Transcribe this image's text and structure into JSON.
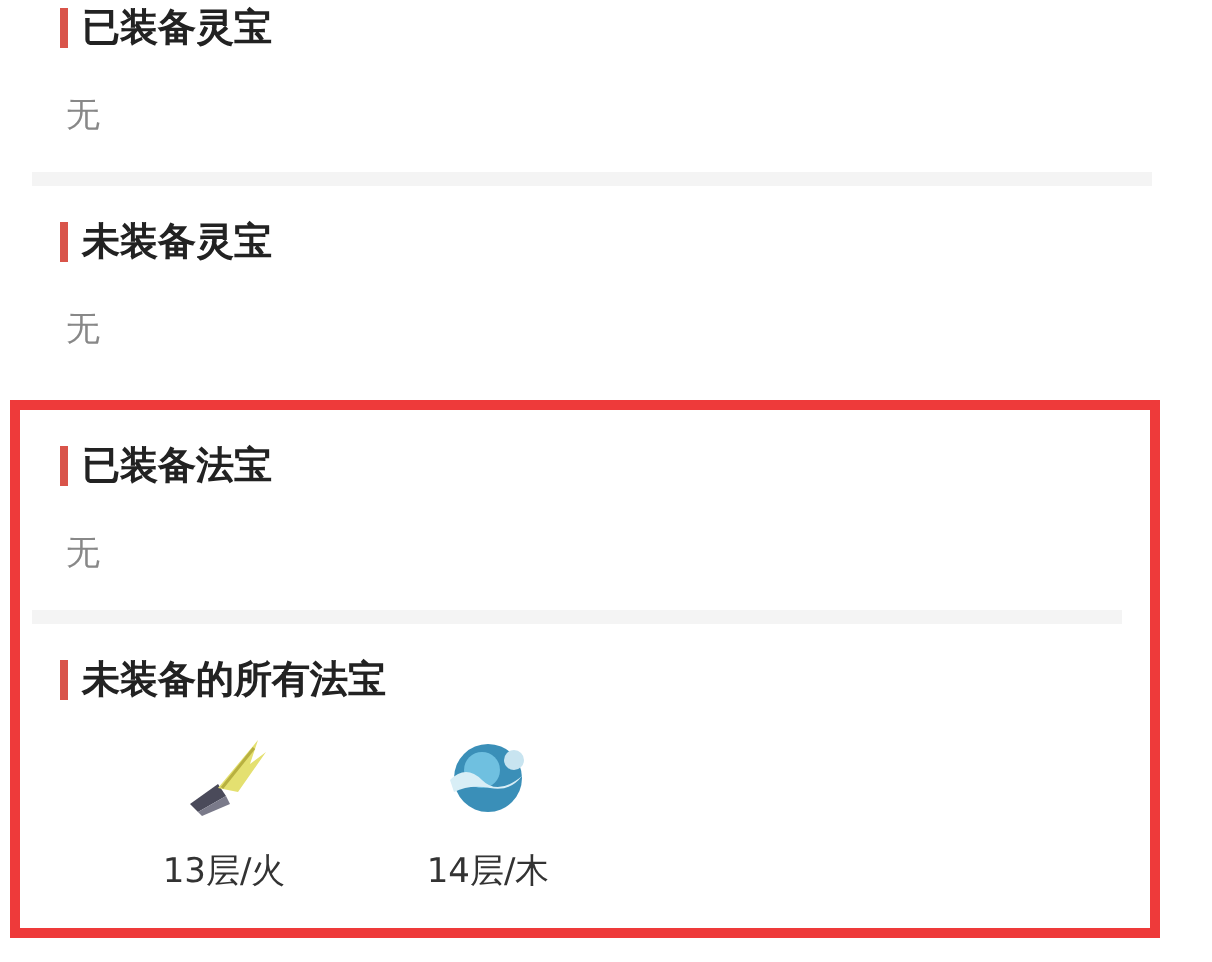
{
  "sections": [
    {
      "title": "已装备灵宝",
      "highlighted": false,
      "empty_text": "无"
    },
    {
      "title": "未装备灵宝",
      "highlighted": false,
      "empty_text": "无"
    },
    {
      "title": "已装备法宝",
      "highlighted": true,
      "empty_text": "无"
    },
    {
      "title": "未装备的所有法宝",
      "highlighted": true,
      "items": [
        {
          "kind": "blade",
          "label": "13层/火"
        },
        {
          "kind": "orb",
          "label": "14层/木"
        }
      ]
    }
  ]
}
